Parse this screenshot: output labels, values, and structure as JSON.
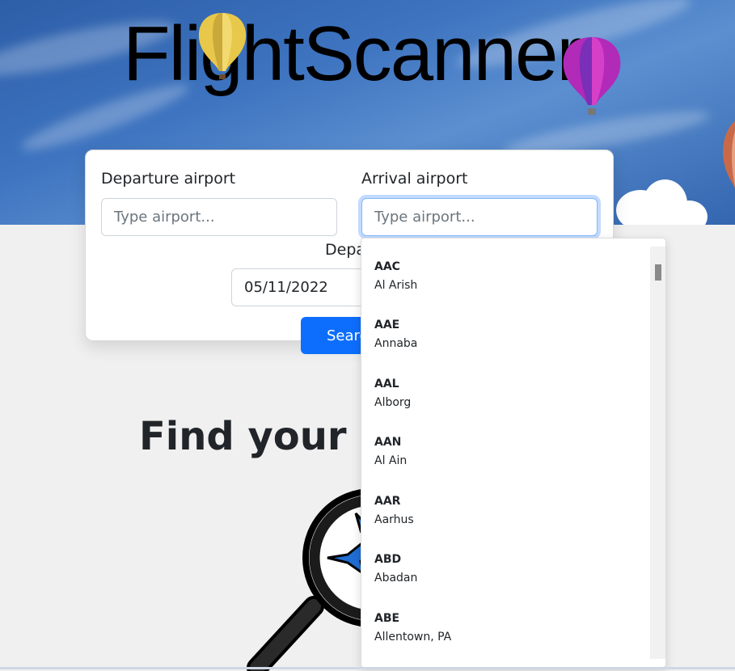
{
  "header": {
    "brand": "FlightScanner"
  },
  "form": {
    "departure_label": "Departure airport",
    "departure_placeholder": "Type airport...",
    "arrival_label": "Arrival airport",
    "arrival_placeholder": "Type airport...",
    "date_label": "Depa",
    "date_value": "05/11/2022",
    "search_label": "Searc"
  },
  "tagline": "Find your dr",
  "dropdown": {
    "items": [
      {
        "code": "AAC",
        "name": "Al Arish"
      },
      {
        "code": "AAE",
        "name": "Annaba"
      },
      {
        "code": "AAL",
        "name": "Alborg"
      },
      {
        "code": "AAN",
        "name": "Al Ain"
      },
      {
        "code": "AAR",
        "name": "Aarhus"
      },
      {
        "code": "ABD",
        "name": "Abadan"
      },
      {
        "code": "ABE",
        "name": "Allentown, PA"
      }
    ]
  },
  "colors": {
    "accent": "#0d6efd",
    "sky": "#3466b0",
    "page_bg": "#f0f0f0"
  }
}
